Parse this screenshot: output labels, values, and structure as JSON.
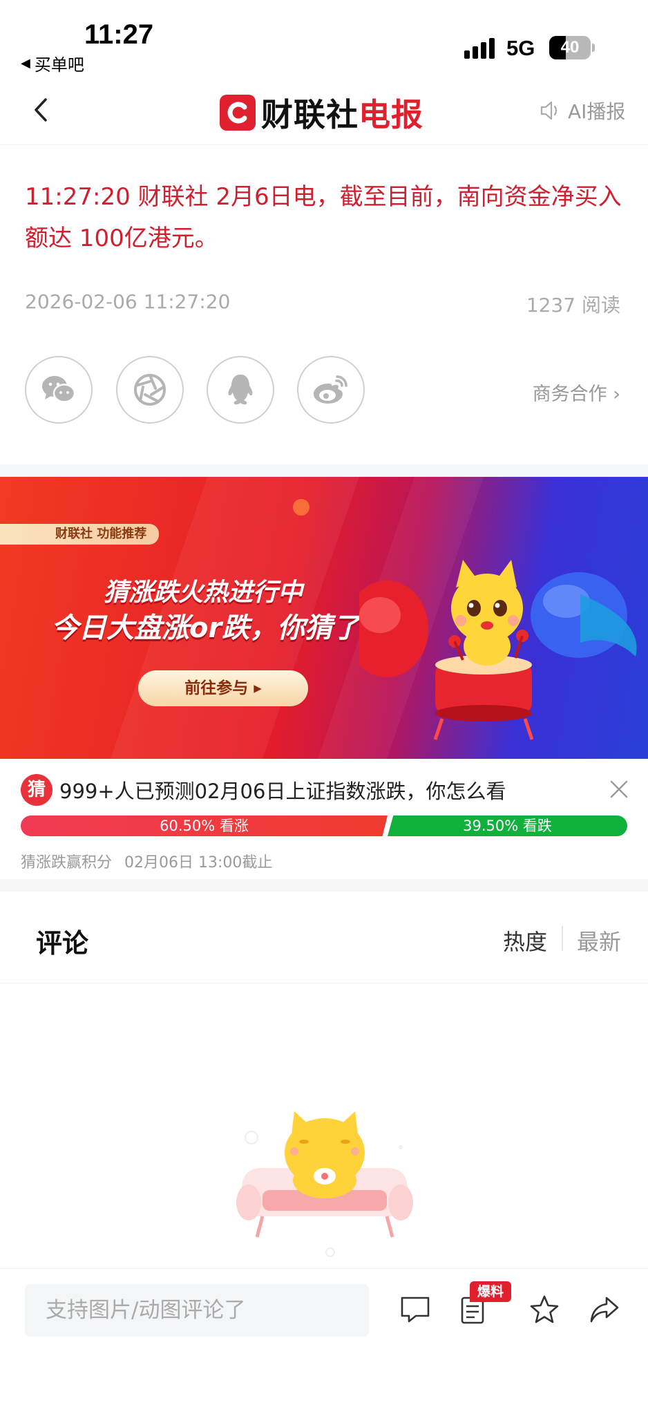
{
  "status_bar": {
    "time": "11:27",
    "back_app": "买单吧",
    "network": "5G",
    "battery": "40",
    "battery_level_percent": 40
  },
  "nav": {
    "logo_text_black": "财联社",
    "logo_text_red": "电报",
    "ai_play": "AI播报"
  },
  "article": {
    "headline": "11:27:20  财联社 2月6日电，截至目前，南向资金净买入额达 100亿港元。",
    "date": "2026-02-06 11:27:20",
    "reads": "1237 阅读"
  },
  "share": {
    "icons": [
      "wechat-icon",
      "moments-icon",
      "qq-icon",
      "weibo-icon"
    ],
    "business": "商务合作 ›"
  },
  "banner": {
    "tag": "财联社  功能推荐",
    "title": "猜涨跌火热进行中",
    "subtitle": "今日大盘涨or跌，你猜了吗?",
    "button": "前往参与 ▸"
  },
  "poll": {
    "icon_text": "猜",
    "question": "999+人已预测02月06日上证指数涨跌，你怎么看",
    "up_label": "60.50% 看涨",
    "down_label": "39.50% 看跌",
    "up_percent": 60.5,
    "down_percent": 39.5,
    "footer_left": "猜涨跌赢积分",
    "footer_right": "02月06日 13:00截止"
  },
  "comments": {
    "title": "评论",
    "sort_hot": "热度",
    "sort_new": "最新"
  },
  "bottom_bar": {
    "input_placeholder": "支持图片/动图评论了",
    "badge": "爆料"
  },
  "colors": {
    "brand_red": "#e0202e",
    "headline_red": "#d01f2e",
    "up_red": "#ef3b2e",
    "down_green": "#10b03c"
  }
}
